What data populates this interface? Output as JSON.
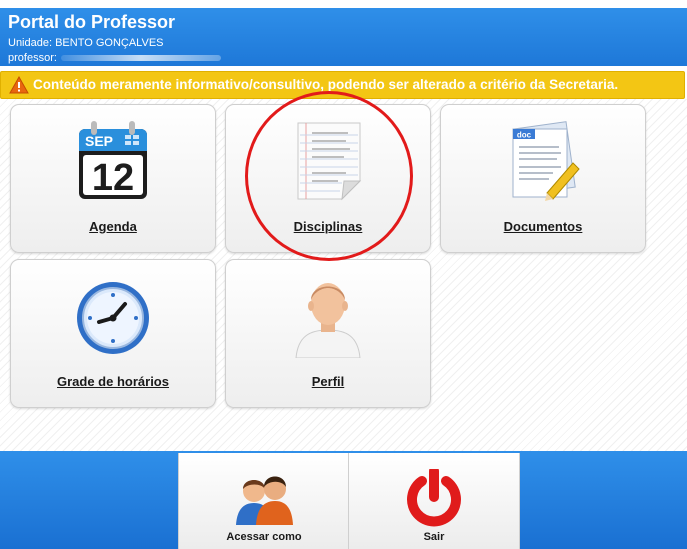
{
  "header": {
    "title": "Portal do Professor",
    "unit_line": "Unidade: BENTO GONÇALVES",
    "professor_label": "professor:"
  },
  "warning": {
    "text": "Conteúdo meramente informativo/consultivo, podendo ser alterado a critério da Secretaria."
  },
  "tiles": [
    {
      "label": "Agenda",
      "icon": "calendar-icon",
      "calendar_month": "SEP",
      "calendar_day": "12"
    },
    {
      "label": "Disciplinas",
      "icon": "notepad-icon"
    },
    {
      "label": "Documentos",
      "icon": "document-icon",
      "doc_tag": "doc"
    },
    {
      "label": "Grade de horários",
      "icon": "clock-icon"
    },
    {
      "label": "Perfil",
      "icon": "user-profile-icon"
    }
  ],
  "footer": {
    "access_as_label": "Acessar como",
    "exit_label": "Sair"
  },
  "colors": {
    "header_blue": "#1e78d8",
    "warning_yellow": "#f3c614",
    "highlight_red": "#e21a1a"
  }
}
